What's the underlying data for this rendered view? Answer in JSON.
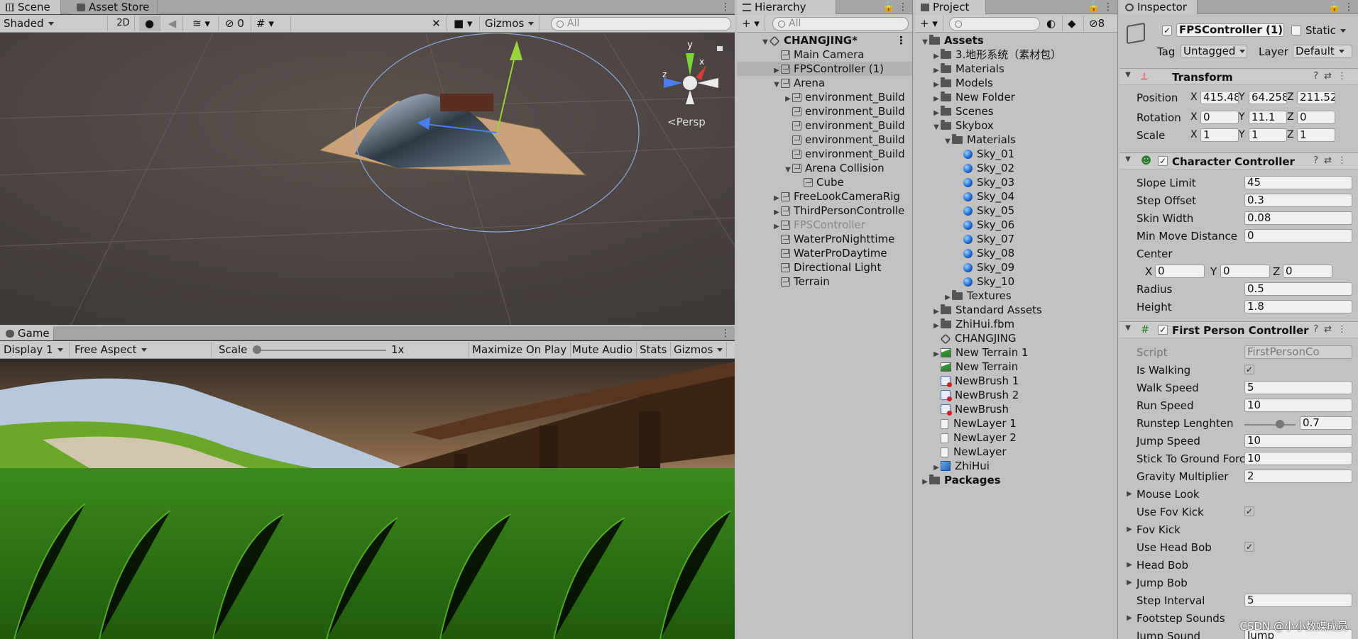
{
  "scene": {
    "tabs": [
      "Scene",
      "Asset Store"
    ],
    "shading_mode": "Shaded",
    "mode_2d": "2D",
    "hidden_count": "0",
    "gizmos_label": "Gizmos",
    "search_placeholder": "All",
    "persp_label": "<Persp",
    "axis_y": "y",
    "axis_x": "x",
    "axis_z": "z"
  },
  "game": {
    "tab": "Game",
    "display": "Display 1",
    "aspect": "Free Aspect",
    "scale_label": "Scale",
    "scale_value": "1x",
    "buttons": [
      "Maximize On Play",
      "Mute Audio",
      "Stats",
      "Gizmos"
    ]
  },
  "hierarchy": {
    "tab": "Hierarchy",
    "search_placeholder": "All",
    "items": [
      {
        "label": "CHANGJING*",
        "depth": 0,
        "arrow": "▼",
        "icon": "unity-scene-icon",
        "bold": true
      },
      {
        "label": "Main Camera",
        "depth": 1,
        "arrow": "",
        "icon": "gameobject-icon"
      },
      {
        "label": "FPSController (1)",
        "depth": 1,
        "arrow": "▶",
        "icon": "gameobject-icon",
        "selected": true
      },
      {
        "label": "Arena",
        "depth": 1,
        "arrow": "▼",
        "icon": "gameobject-icon"
      },
      {
        "label": "environment_Build",
        "depth": 2,
        "arrow": "▶",
        "icon": "gameobject-icon"
      },
      {
        "label": "environment_Build",
        "depth": 2,
        "arrow": "",
        "icon": "gameobject-icon"
      },
      {
        "label": "environment_Build",
        "depth": 2,
        "arrow": "",
        "icon": "gameobject-icon"
      },
      {
        "label": "environment_Build",
        "depth": 2,
        "arrow": "",
        "icon": "gameobject-icon"
      },
      {
        "label": "environment_Build",
        "depth": 2,
        "arrow": "",
        "icon": "gameobject-icon"
      },
      {
        "label": "Arena Collision",
        "depth": 2,
        "arrow": "▼",
        "icon": "gameobject-icon"
      },
      {
        "label": "Cube",
        "depth": 3,
        "arrow": "",
        "icon": "gameobject-icon"
      },
      {
        "label": "FreeLookCameraRig",
        "depth": 1,
        "arrow": "▶",
        "icon": "gameobject-icon"
      },
      {
        "label": "ThirdPersonControlle",
        "depth": 1,
        "arrow": "▶",
        "icon": "gameobject-icon"
      },
      {
        "label": "FPSController",
        "depth": 1,
        "arrow": "▶",
        "icon": "gameobject-icon",
        "disabled": true
      },
      {
        "label": "WaterProNighttime",
        "depth": 1,
        "arrow": "",
        "icon": "gameobject-icon"
      },
      {
        "label": "WaterProDaytime",
        "depth": 1,
        "arrow": "",
        "icon": "gameobject-icon"
      },
      {
        "label": "Directional Light",
        "depth": 1,
        "arrow": "",
        "icon": "gameobject-icon"
      },
      {
        "label": "Terrain",
        "depth": 1,
        "arrow": "",
        "icon": "gameobject-icon"
      }
    ]
  },
  "project": {
    "tab": "Project",
    "hidden_count": "8",
    "items": [
      {
        "label": "Assets",
        "depth": 0,
        "arrow": "▼",
        "icon": "folder",
        "bold": true
      },
      {
        "label": "3.地形系统（素材包）",
        "depth": 1,
        "arrow": "▶",
        "icon": "folder"
      },
      {
        "label": "Materials",
        "depth": 1,
        "arrow": "▶",
        "icon": "folder"
      },
      {
        "label": "Models",
        "depth": 1,
        "arrow": "▶",
        "icon": "folder"
      },
      {
        "label": "New Folder",
        "depth": 1,
        "arrow": "▶",
        "icon": "folder"
      },
      {
        "label": "Scenes",
        "depth": 1,
        "arrow": "▶",
        "icon": "folder"
      },
      {
        "label": "Skybox",
        "depth": 1,
        "arrow": "▼",
        "icon": "folder"
      },
      {
        "label": "Materials",
        "depth": 2,
        "arrow": "▼",
        "icon": "folder"
      },
      {
        "label": "Sky_01",
        "depth": 3,
        "arrow": "",
        "icon": "sphere"
      },
      {
        "label": "Sky_02",
        "depth": 3,
        "arrow": "",
        "icon": "sphere"
      },
      {
        "label": "Sky_03",
        "depth": 3,
        "arrow": "",
        "icon": "sphere"
      },
      {
        "label": "Sky_04",
        "depth": 3,
        "arrow": "",
        "icon": "sphere"
      },
      {
        "label": "Sky_05",
        "depth": 3,
        "arrow": "",
        "icon": "sphere"
      },
      {
        "label": "Sky_06",
        "depth": 3,
        "arrow": "",
        "icon": "sphere"
      },
      {
        "label": "Sky_07",
        "depth": 3,
        "arrow": "",
        "icon": "sphere"
      },
      {
        "label": "Sky_08",
        "depth": 3,
        "arrow": "",
        "icon": "sphere"
      },
      {
        "label": "Sky_09",
        "depth": 3,
        "arrow": "",
        "icon": "sphere"
      },
      {
        "label": "Sky_10",
        "depth": 3,
        "arrow": "",
        "icon": "sphere"
      },
      {
        "label": "Textures",
        "depth": 2,
        "arrow": "▶",
        "icon": "folder"
      },
      {
        "label": "Standard Assets",
        "depth": 1,
        "arrow": "▶",
        "icon": "folder"
      },
      {
        "label": "ZhiHui.fbm",
        "depth": 1,
        "arrow": "▶",
        "icon": "folder"
      },
      {
        "label": "CHANGJING",
        "depth": 1,
        "arrow": "",
        "icon": "unity"
      },
      {
        "label": "New Terrain 1",
        "depth": 1,
        "arrow": "▶",
        "icon": "terrain"
      },
      {
        "label": "New Terrain",
        "depth": 1,
        "arrow": "",
        "icon": "terrain"
      },
      {
        "label": "NewBrush 1",
        "depth": 1,
        "arrow": "",
        "icon": "brush"
      },
      {
        "label": "NewBrush 2",
        "depth": 1,
        "arrow": "",
        "icon": "brush"
      },
      {
        "label": "NewBrush",
        "depth": 1,
        "arrow": "",
        "icon": "brush"
      },
      {
        "label": "NewLayer 1",
        "depth": 1,
        "arrow": "",
        "icon": "doc"
      },
      {
        "label": "NewLayer 2",
        "depth": 1,
        "arrow": "",
        "icon": "doc"
      },
      {
        "label": "NewLayer",
        "depth": 1,
        "arrow": "",
        "icon": "doc"
      },
      {
        "label": "ZhiHui",
        "depth": 1,
        "arrow": "▶",
        "icon": "prefab"
      },
      {
        "label": "Packages",
        "depth": 0,
        "arrow": "▶",
        "icon": "folder",
        "bold": true
      }
    ]
  },
  "inspector": {
    "tab": "Inspector",
    "object_name": "FPSController (1)",
    "static_label": "Static",
    "tag_label": "Tag",
    "tag_value": "Untagged",
    "layer_label": "Layer",
    "layer_value": "Default",
    "transform": {
      "title": "Transform",
      "position_label": "Position",
      "position": [
        "415.48",
        "64.258",
        "211.52"
      ],
      "rotation_label": "Rotation",
      "rotation": [
        "0",
        "11.1",
        "0"
      ],
      "scale_label": "Scale",
      "scale": [
        "1",
        "1",
        "1"
      ],
      "axes": [
        "X",
        "Y",
        "Z"
      ]
    },
    "character_controller": {
      "title": "Character Controller",
      "fields": [
        {
          "label": "Slope Limit",
          "value": "45"
        },
        {
          "label": "Step Offset",
          "value": "0.3"
        },
        {
          "label": "Skin Width",
          "value": "0.08"
        },
        {
          "label": "Min Move Distance",
          "value": "0"
        }
      ],
      "center_label": "Center",
      "center": [
        "0",
        "0",
        "0"
      ],
      "radius_label": "Radius",
      "radius": "0.5",
      "height_label": "Height",
      "height": "1.8"
    },
    "fps": {
      "title": "First Person Controller",
      "script_label": "Script",
      "script_value": "FirstPersonCo",
      "is_walking_label": "Is Walking",
      "walk_speed_label": "Walk Speed",
      "walk_speed": "5",
      "run_speed_label": "Run Speed",
      "run_speed": "10",
      "runstep_label": "Runstep Lenghten",
      "runstep": "0.7",
      "runstep_fraction": 0.7,
      "jump_speed_label": "Jump Speed",
      "jump_speed": "10",
      "stick_label": "Stick To Ground Forc",
      "stick": "10",
      "gravity_label": "Gravity Multiplier",
      "gravity": "2",
      "mouse_look_label": "Mouse Look",
      "use_fov_label": "Use Fov Kick",
      "fov_kick_label": "Fov Kick",
      "use_head_bob_label": "Use Head Bob",
      "head_bob_label": "Head Bob",
      "jump_bob_label": "Jump Bob",
      "step_interval_label": "Step Interval",
      "step_interval": "5",
      "footstep_label": "Footstep Sounds",
      "jump_sound_label": "Jump Sound",
      "jump_sound_value": "Jump"
    }
  },
  "watermark": "CSDN @小小数媒成员"
}
